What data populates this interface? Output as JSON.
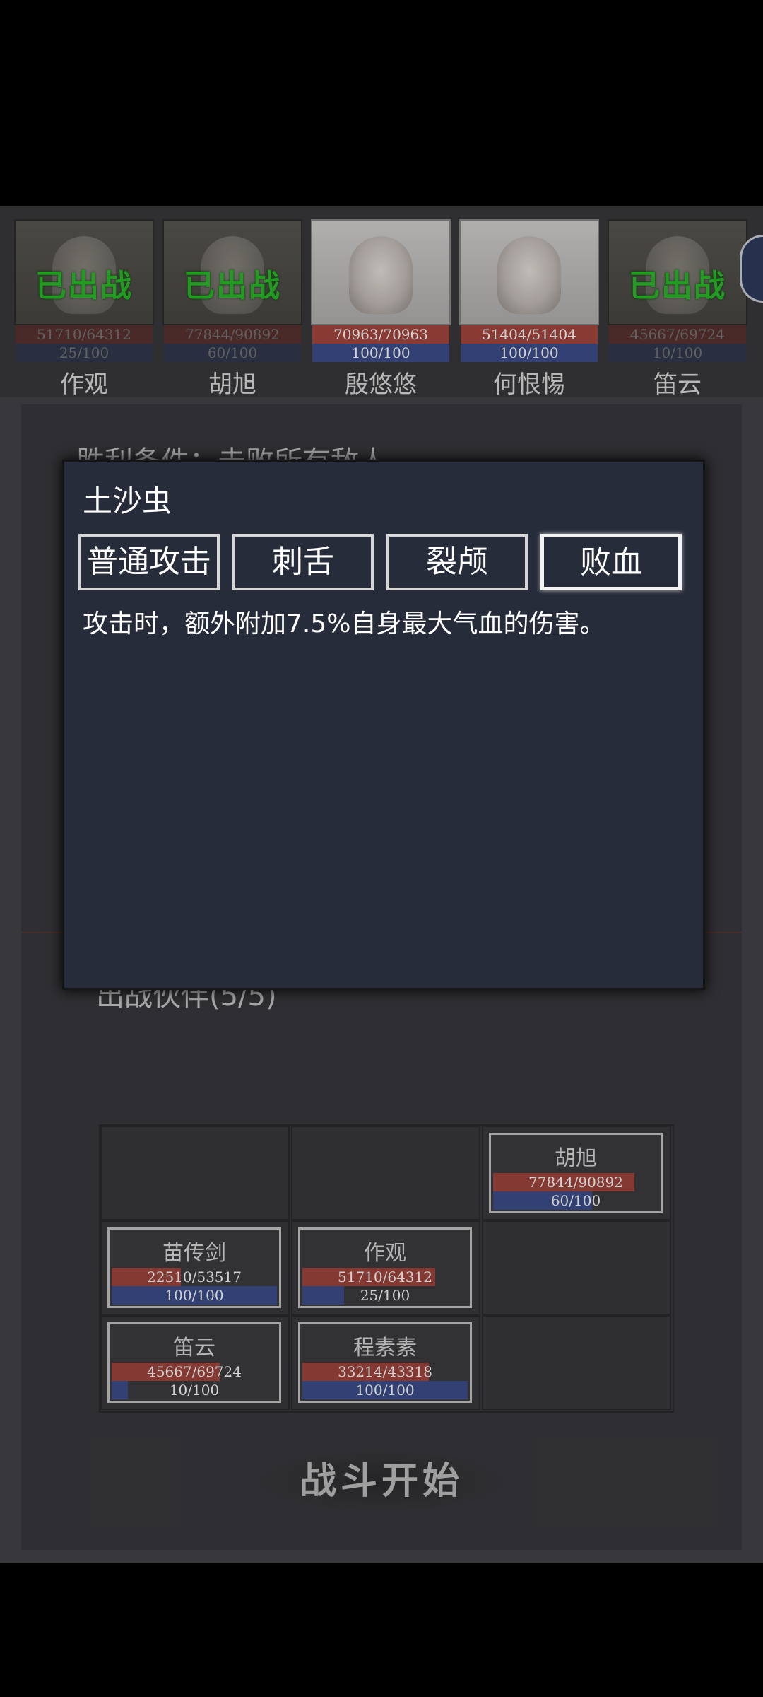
{
  "roster": [
    {
      "name": "作观",
      "hp": "51710/64312",
      "mp": "25/100",
      "status": "已出战",
      "active": false
    },
    {
      "name": "胡旭",
      "hp": "77844/90892",
      "mp": "60/100",
      "status": "已出战",
      "active": false
    },
    {
      "name": "殷悠悠",
      "hp": "70963/70963",
      "mp": "100/100",
      "status": "",
      "active": true
    },
    {
      "name": "何恨惕",
      "hp": "51404/51404",
      "mp": "100/100",
      "status": "",
      "active": true
    },
    {
      "name": "笛云",
      "hp": "45667/69724",
      "mp": "10/100",
      "status": "已出战",
      "active": false
    }
  ],
  "panel": {
    "victory_condition": "胜利条件：击败所有敌人",
    "party_title": "出战伙伴(5/5)",
    "start_button": "战斗开始"
  },
  "formation": [
    {
      "name": "胡旭",
      "hp": "77844/90892",
      "hp_ratio": 0.856,
      "mp": "60/100",
      "mp_ratio": 0.6
    },
    {
      "name": "苗传剑",
      "hp": "22510/53517",
      "hp_ratio": 0.42,
      "mp": "100/100",
      "mp_ratio": 1.0
    },
    {
      "name": "作观",
      "hp": "51710/64312",
      "hp_ratio": 0.804,
      "mp": "25/100",
      "mp_ratio": 0.25
    },
    {
      "name": "笛云",
      "hp": "45667/69724",
      "hp_ratio": 0.655,
      "mp": "10/100",
      "mp_ratio": 0.1
    },
    {
      "name": "程素素",
      "hp": "33214/43318",
      "hp_ratio": 0.767,
      "mp": "100/100",
      "mp_ratio": 1.0
    }
  ],
  "modal": {
    "title": "土沙虫",
    "tabs": [
      "普通攻击",
      "刺舌",
      "裂颅",
      "败血"
    ],
    "selected_tab": 3,
    "description": "攻击时，额外附加7.5%自身最大气血的伤害。"
  }
}
